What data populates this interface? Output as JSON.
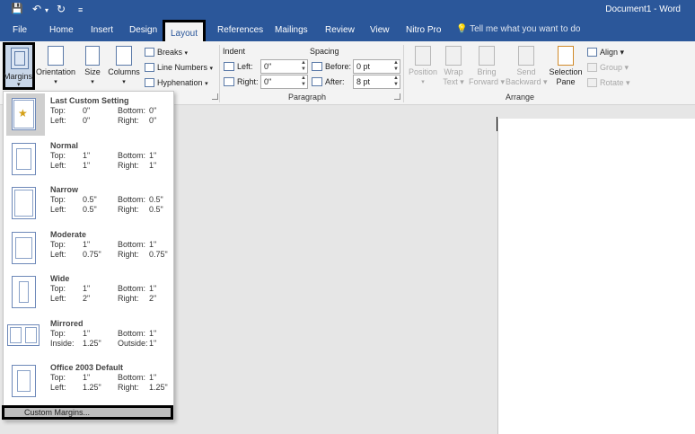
{
  "title_bar": {
    "doc_title": "Document1 - Word"
  },
  "qat": {
    "save_glyph": "💾",
    "undo_glyph": "↶",
    "undo_drop": "▾",
    "redo_glyph": "↻",
    "customize_glyph": "≡"
  },
  "tabs": [
    {
      "label": "File"
    },
    {
      "label": "Home"
    },
    {
      "label": "Insert"
    },
    {
      "label": "Design"
    },
    {
      "label": "Layout"
    },
    {
      "label": "References"
    },
    {
      "label": "Mailings"
    },
    {
      "label": "Review"
    },
    {
      "label": "View"
    },
    {
      "label": "Nitro Pro"
    }
  ],
  "tell_me": {
    "icon": "lightbulb-icon",
    "glyph": "💡",
    "text": "Tell me what you want to do"
  },
  "page_setup": {
    "margins": "Margins",
    "orientation": "Orientation",
    "size": "Size",
    "columns": "Columns",
    "breaks": "Breaks",
    "line_numbers": "Line Numbers",
    "hyphenation": "Hyphenation",
    "drop_glyph": "▾"
  },
  "paragraph": {
    "group_label": "Paragraph",
    "indent_label": "Indent",
    "spacing_label": "Spacing",
    "left_label": "Left:",
    "left_value": "0\"",
    "right_label": "Right:",
    "right_value": "0\"",
    "before_label": "Before:",
    "before_value": "0 pt",
    "after_label": "After:",
    "after_value": "8 pt",
    "spin_glyph": "▲\n▼"
  },
  "arrange": {
    "group_label": "Arrange",
    "position": [
      "Position",
      "▾"
    ],
    "wrap_text": [
      "Wrap",
      "Text ▾"
    ],
    "bring_forward": [
      "Bring",
      "Forward ▾"
    ],
    "send_backward": [
      "Send",
      "Backward ▾"
    ],
    "selection_pane": [
      "Selection",
      "Pane"
    ],
    "align": "Align ▾",
    "group": "Group ▾",
    "rotate": "Rotate ▾"
  },
  "margins_menu": {
    "options": [
      {
        "name": "Last Custom Setting",
        "k1": "Top:",
        "v1": "0\"",
        "k2": "Bottom:",
        "v2": "0\"",
        "k3": "Left:",
        "v3": "0\"",
        "k4": "Right:",
        "v4": "0\""
      },
      {
        "name": "Normal",
        "k1": "Top:",
        "v1": "1\"",
        "k2": "Bottom:",
        "v2": "1\"",
        "k3": "Left:",
        "v3": "1\"",
        "k4": "Right:",
        "v4": "1\""
      },
      {
        "name": "Narrow",
        "k1": "Top:",
        "v1": "0.5\"",
        "k2": "Bottom:",
        "v2": "0.5\"",
        "k3": "Left:",
        "v3": "0.5\"",
        "k4": "Right:",
        "v4": "0.5\""
      },
      {
        "name": "Moderate",
        "k1": "Top:",
        "v1": "1\"",
        "k2": "Bottom:",
        "v2": "1\"",
        "k3": "Left:",
        "v3": "0.75\"",
        "k4": "Right:",
        "v4": "0.75\""
      },
      {
        "name": "Wide",
        "k1": "Top:",
        "v1": "1\"",
        "k2": "Bottom:",
        "v2": "1\"",
        "k3": "Left:",
        "v3": "2\"",
        "k4": "Right:",
        "v4": "2\""
      },
      {
        "name": "Mirrored",
        "k1": "Top:",
        "v1": "1\"",
        "k2": "Bottom:",
        "v2": "1\"",
        "k3": "Inside:",
        "v3": "1.25\"",
        "k4": "Outside:",
        "v4": "1\""
      },
      {
        "name": "Office 2003 Default",
        "k1": "Top:",
        "v1": "1\"",
        "k2": "Bottom:",
        "v2": "1\"",
        "k3": "Left:",
        "v3": "1.25\"",
        "k4": "Right:",
        "v4": "1.25\""
      }
    ],
    "custom_margins": "Custom Margins..."
  },
  "colors": {
    "accent": "#2b579a",
    "highlight": "#000000"
  }
}
